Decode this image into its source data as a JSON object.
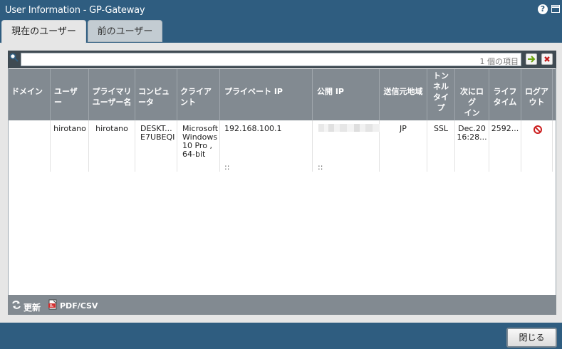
{
  "window": {
    "title": "User Information - GP-Gateway",
    "help_icon": "help-icon",
    "window_icon": "window-icon"
  },
  "tabs": [
    {
      "label": "現在のユーザー",
      "selected": true
    },
    {
      "label": "前のユーザー",
      "selected": false
    }
  ],
  "search": {
    "value": "",
    "placeholder": "",
    "count_label": "1 個の項目",
    "go_icon": "arrow-right-icon",
    "clear_icon": "x-icon"
  },
  "table": {
    "headers": [
      "ドメイン",
      "ユーザー",
      "プライマリユーザー名",
      "コンピューター",
      "クライアント",
      "プライベート IP",
      "公開 IP",
      "送信元地域",
      "トンネルタイプ",
      "次にログイン",
      "ライフタイム",
      "ログアウト"
    ],
    "header_lines": [
      [
        "ドメイン"
      ],
      [
        "ユーザ",
        "ー"
      ],
      [
        "プライマリ",
        "ユーザー名"
      ],
      [
        "コンピュ",
        "ータ"
      ],
      [
        "クライア",
        "ント"
      ],
      [
        "プライベート IP"
      ],
      [
        "公開 IP"
      ],
      [
        "送信元地域"
      ],
      [
        "トン",
        "ネル",
        "タイ",
        "プ"
      ],
      [
        "次にログ",
        "イン"
      ],
      [
        "ライフ",
        "タイム"
      ],
      [
        "ログア",
        "ウト"
      ]
    ],
    "rows": [
      {
        "domain": "",
        "user": "hirotano",
        "primary_user": "hirotano",
        "computer_line1": "DESKT...",
        "computer_line2": "E7UBEQI",
        "client_line1": "Microsoft",
        "client_line2": "Windows",
        "client_line3": "10 Pro ,",
        "client_line4": "64-bit",
        "private_ip": "192.168.100.1",
        "private_ipv6": "::",
        "public_ipv6": "::",
        "source_region": "JP",
        "tunnel_type": "SSL",
        "login_line1": "Dec.20",
        "login_line2": "16:28...",
        "lifetime": "2592...",
        "logout_icon": "no-entry-icon"
      }
    ]
  },
  "footer": {
    "refresh_label": "更新",
    "refresh_icon": "refresh-icon",
    "export_label": "PDF/CSV",
    "export_icon": "pdf-csv-icon"
  },
  "buttons": {
    "close_label": "閉じる"
  },
  "colors": {
    "titlebar": "#2f5d80",
    "panel": "#e6e6e6",
    "table_header": "#828a91",
    "toolbar": "#3f4a52",
    "logout_red": "#cc1f1f"
  }
}
